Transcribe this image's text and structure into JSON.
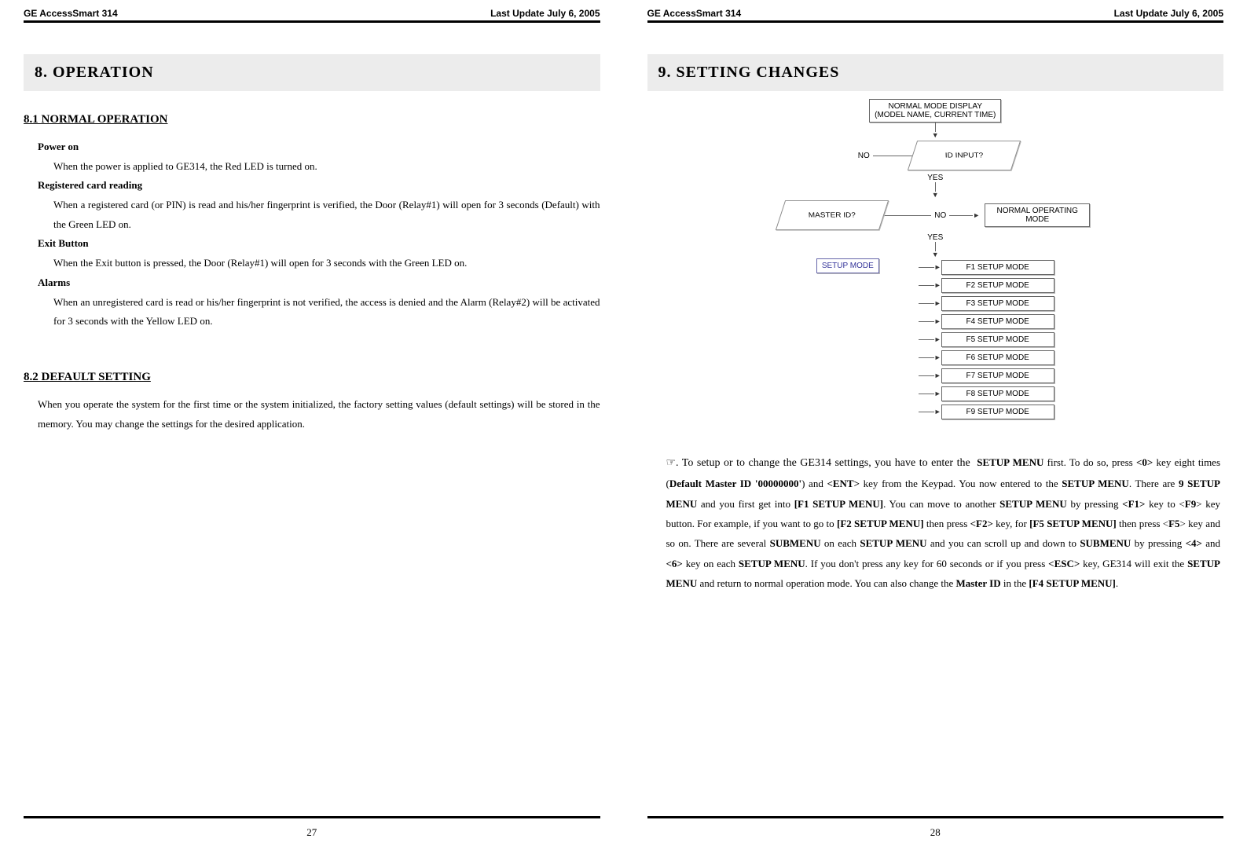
{
  "header": {
    "left": "GE AccessSmart 314",
    "right": "Last Update July 6, 2005"
  },
  "left_page": {
    "section_title": "8.  OPERATION",
    "sub1": "8.1 NORMAL OPERATION",
    "items": [
      {
        "title": "Power on",
        "body": "When the power is applied to GE314, the Red LED is turned on."
      },
      {
        "title": "Registered card reading",
        "body": "When a registered card (or PIN) is read and his/her fingerprint is verified, the Door (Relay#1) will open for 3 seconds (Default) with the Green LED on."
      },
      {
        "title": "Exit Button",
        "body": "When the Exit button is pressed, the Door (Relay#1) will open for 3 seconds with the Green LED on."
      },
      {
        "title": "Alarms",
        "body": "When an unregistered card is read or his/her fingerprint is not verified, the access is denied and the Alarm (Relay#2) will be activated for 3 seconds with the Yellow LED on."
      }
    ],
    "sub2": "8.2 DEFAULT SETTING",
    "default_text": "When you operate the system for the first time or the system initialized, the factory setting values (default settings) will be stored in the memory. You may change the settings for the desired application.",
    "page_num": "27"
  },
  "right_page": {
    "section_title": "9.  SETTING CHANGES",
    "flow": {
      "top": "NORMAL MODE DISPLAY\n(MODEL NAME, CURRENT TIME)",
      "d1": "ID INPUT?",
      "no": "NO",
      "yes": "YES",
      "d2": "MASTER ID?",
      "normal_op": "NORMAL OPERATING MODE",
      "setup": "SETUP MODE",
      "menus": [
        "F1 SETUP MODE",
        "F2 SETUP MODE",
        "F3 SETUP MODE",
        "F4 SETUP MODE",
        "F5 SETUP MODE",
        "F6 SETUP MODE",
        "F7 SETUP MODE",
        "F8 SETUP MODE",
        "F9 SETUP MODE"
      ]
    },
    "instr_lead": "☞.  To setup or to change the GE314 settings, you have to enter the ",
    "k_setup_menu": "SETUP MENU",
    "t1": " first. To do so, press ",
    "k_0": "<0>",
    "t2": " key eight times (",
    "k_def_master": "Default Master ID '00000000'",
    "t3": ") and ",
    "k_ent": "<ENT>",
    "t4": " key from the Keypad. You now entered to the ",
    "t5": ". There are ",
    "k_9setup": "9 SETUP MENU",
    "t6": " and you first get into ",
    "k_f1m": "[F1 SETUP MENU]",
    "t7": ". You can move to another ",
    "t8": " by pressing ",
    "k_f1": "<F1>",
    "t9": " key to <",
    "k_f9": "F9",
    "t10": "> key button. For example, if you want to go to ",
    "k_f2m": "[F2 SETUP MENU]",
    "t11": " then press ",
    "k_f2": "<F2>",
    "t12": " key, for ",
    "k_f5m": "[F5 SETUP MENU]",
    "t13": " then press <",
    "k_f5": "F5",
    "t14": "> key and so on. There are several ",
    "k_submenu": "SUBMENU",
    "t15": " on each ",
    "t16": " and you can scroll up and down to ",
    "t17": " by pressing ",
    "k_4": "<4>",
    "t18": " and ",
    "k_6": "<6>",
    "t19": " key on each ",
    "t20": ". If you don't press any key for 60 seconds or if you press ",
    "k_esc": "<ESC>",
    "t21": " key, GE314 will exit the ",
    "t22": " and return to normal operation mode. You can also change the ",
    "k_masterid": "Master ID",
    "t23": " in the ",
    "k_f4m": "[F4 SETUP MENU]",
    "t24": ".",
    "page_num": "28"
  }
}
